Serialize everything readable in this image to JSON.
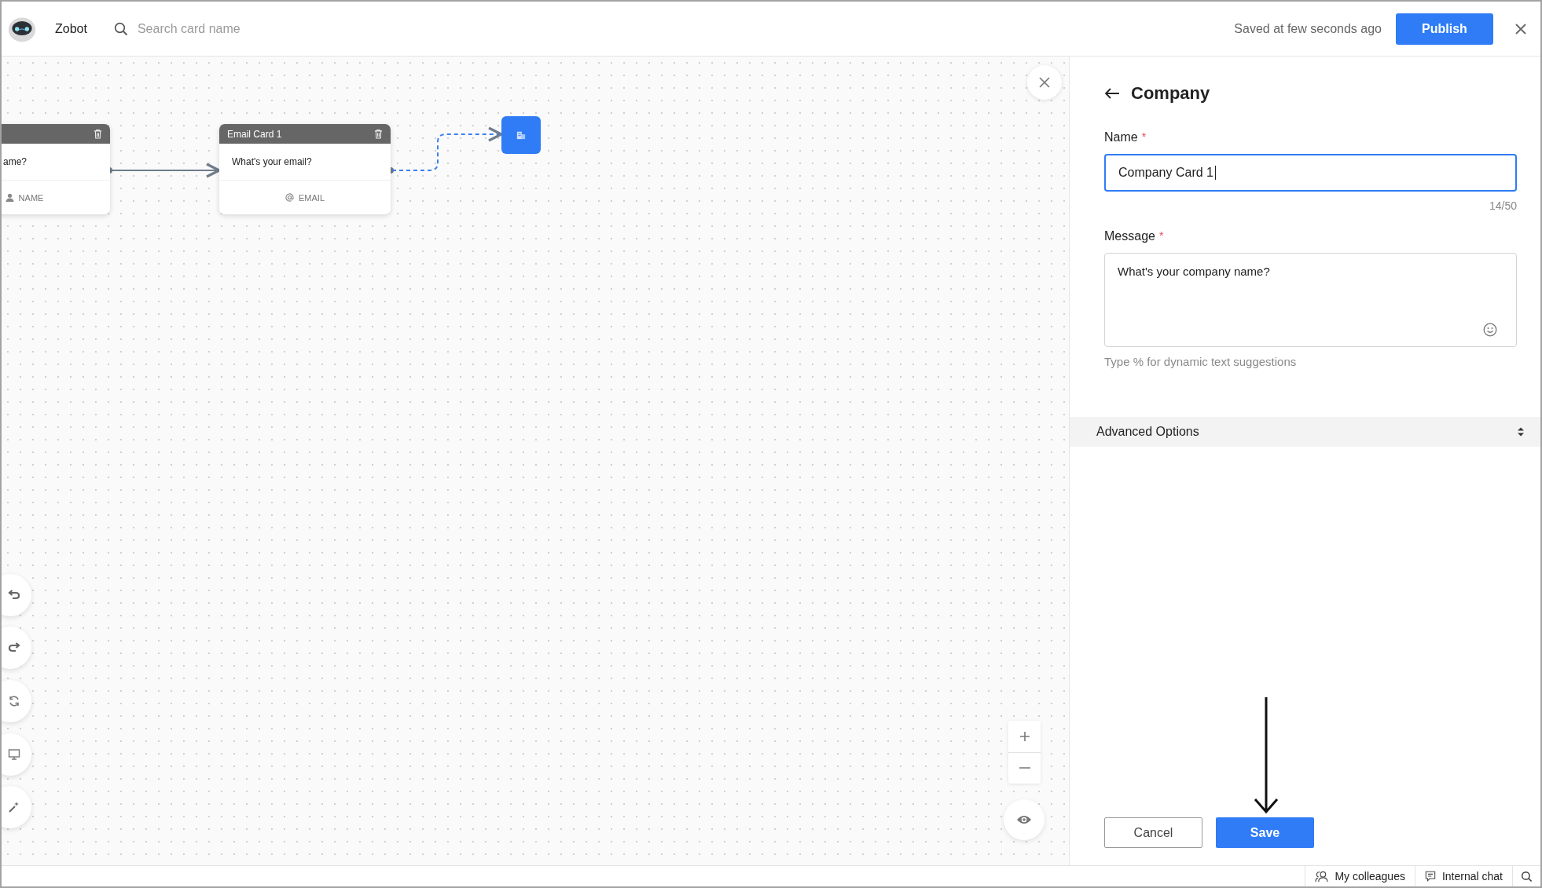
{
  "header": {
    "app_name": "Zobot",
    "search": {
      "placeholder": "Search card name"
    },
    "save_status": "Saved at few seconds ago",
    "publish_button": "Publish"
  },
  "canvas": {
    "cards": [
      {
        "message": "ame?",
        "field_label": "NAME",
        "kind": "name"
      },
      {
        "title": "Email Card 1",
        "message": "What's your email?",
        "field_label": "EMAIL",
        "kind": "email"
      }
    ],
    "tools": [
      {
        "kind": "undo"
      },
      {
        "kind": "redo"
      },
      {
        "kind": "refresh"
      },
      {
        "kind": "monitor"
      },
      {
        "kind": "wand"
      }
    ]
  },
  "panel": {
    "title": "Company",
    "fields": [
      {
        "kind": "input",
        "label": "Name",
        "required_mark": "*",
        "value": "Company Card 1",
        "counter": "14/50",
        "focused": true
      },
      {
        "kind": "textarea",
        "label": "Message",
        "required_mark": "*",
        "value": "What's your company name?",
        "hint": "Type % for dynamic text suggestions",
        "focused": false
      }
    ],
    "advanced_options": "Advanced Options",
    "buttons": [
      {
        "label": "Cancel",
        "kind": "secondary"
      },
      {
        "label": "Save",
        "kind": "primary"
      }
    ]
  },
  "status_bar": {
    "items": [
      {
        "label": "My colleagues",
        "kind": "people"
      },
      {
        "label": "Internal chat",
        "kind": "chat"
      }
    ]
  }
}
